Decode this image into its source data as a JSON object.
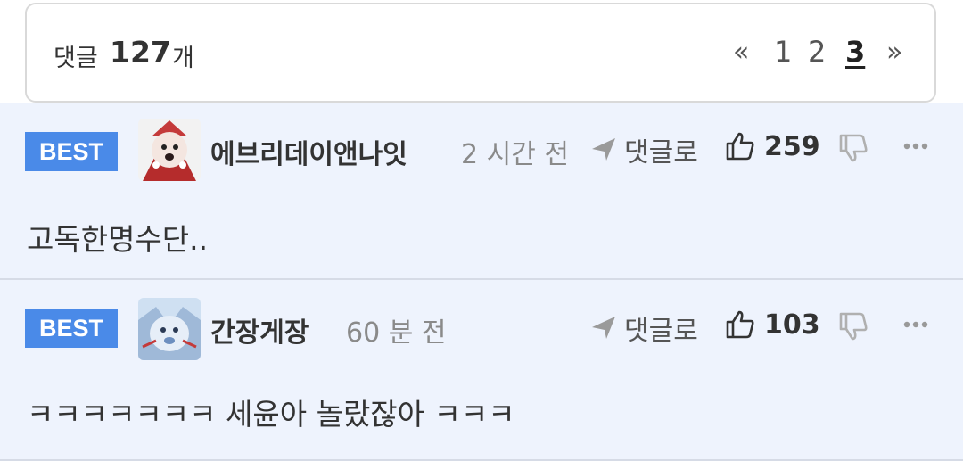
{
  "comments_header": {
    "label": "댓글",
    "count": "127",
    "unit": "개",
    "pagination": {
      "first": "«",
      "pages": [
        "1",
        "2",
        "3"
      ],
      "current": "3",
      "last": "»"
    }
  },
  "comments": [
    {
      "badge": "BEST",
      "avatar": "avatar-icon",
      "username": "에브리데이앤나잇",
      "time": "2 시간 전",
      "reply_label": "댓글로",
      "likes": "259",
      "text": "고독한명수단.."
    },
    {
      "badge": "BEST",
      "avatar": "avatar-icon",
      "username": "간장게장",
      "time": "60 분 전",
      "reply_label": "댓글로",
      "likes": "103",
      "text": "ㅋㅋㅋㅋㅋㅋㅋ 세윤아 놀랐잖아 ㅋㅋㅋ"
    }
  ],
  "colors": {
    "accent": "#4a8ae8",
    "comment_bg": "#eef3fd",
    "border": "#d9d9d9"
  }
}
